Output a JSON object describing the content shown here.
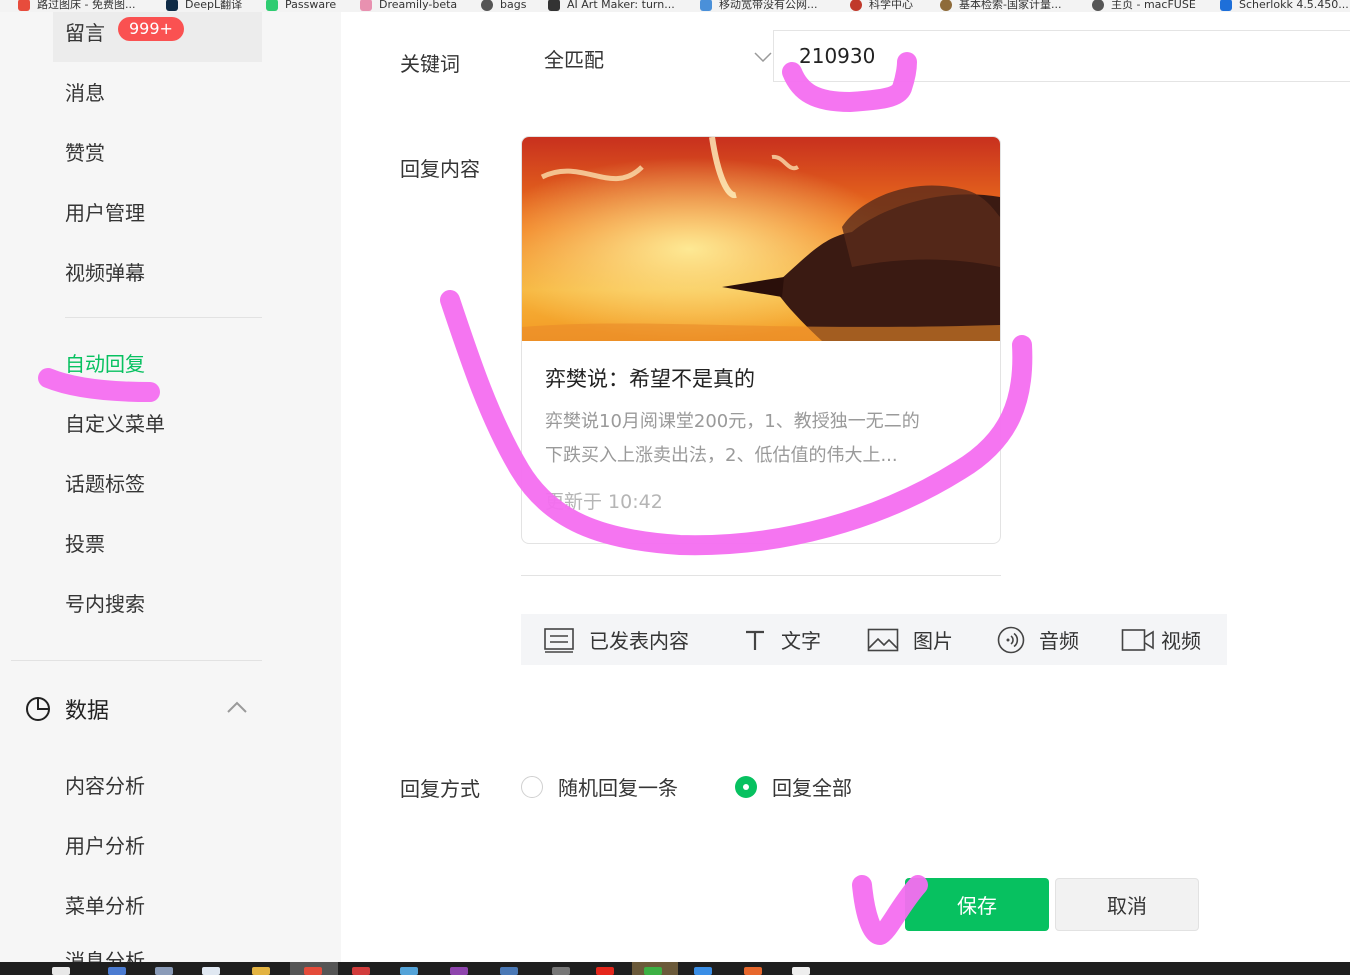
{
  "bookmarks": [
    {
      "label": "路过图床 - 免费图...",
      "color": "#e74c3c"
    },
    {
      "label": "DeepL翻译",
      "color": "#0f2b46"
    },
    {
      "label": "Passware",
      "color": "#2ecc71"
    },
    {
      "label": "Dreamily-beta",
      "color": "#e891b0"
    },
    {
      "label": "bags",
      "color": "#555555"
    },
    {
      "label": "AI Art Maker: turn...",
      "color": "#333333"
    },
    {
      "label": "移动宽带没有公网...",
      "color": "#4a90d9"
    },
    {
      "label": "科学中心",
      "color": "#c0392b"
    },
    {
      "label": "基本检索-国家计量...",
      "color": "#8e6b3a"
    },
    {
      "label": "主页 - macFUSE",
      "color": "#555555"
    },
    {
      "label": "Scherlokk 4.5.450...",
      "color": "#1e6fd9"
    }
  ],
  "sidebar": {
    "comments": {
      "label": "留言",
      "badge": "999+"
    },
    "items": [
      "消息",
      "赞赏",
      "用户管理",
      "视频弹幕"
    ],
    "items2": [
      "自动回复",
      "自定义菜单",
      "话题标签",
      "投票",
      "号内搜索"
    ],
    "active": "自动回复",
    "data_group": {
      "label": "数据"
    },
    "data_items": [
      "内容分析",
      "用户分析",
      "菜单分析",
      "消息分析"
    ]
  },
  "form": {
    "keyword_label": "关键词",
    "match_mode": "全匹配",
    "keyword_value": "210930",
    "reply_content_label": "回复内容",
    "article": {
      "title": "弈樊说：希望不是真的",
      "desc_line1": "弈樊说10月阅课堂200元，1、教授独一无二的",
      "desc_line2": "下跌买入上涨卖出法，2、低估值的伟大上...",
      "time": "更新于 10:42"
    },
    "toolbar": {
      "published": "已发表内容",
      "text": "文字",
      "image": "图片",
      "audio": "音频",
      "video": "视频"
    },
    "reply_mode_label": "回复方式",
    "reply_mode_options": [
      "随机回复一条",
      "回复全部"
    ],
    "reply_mode_selected": "回复全部",
    "save": "保存",
    "cancel": "取消"
  },
  "colors": {
    "accent": "#07c160",
    "badge": "#fa5151",
    "annotation": "#f46ef0"
  }
}
